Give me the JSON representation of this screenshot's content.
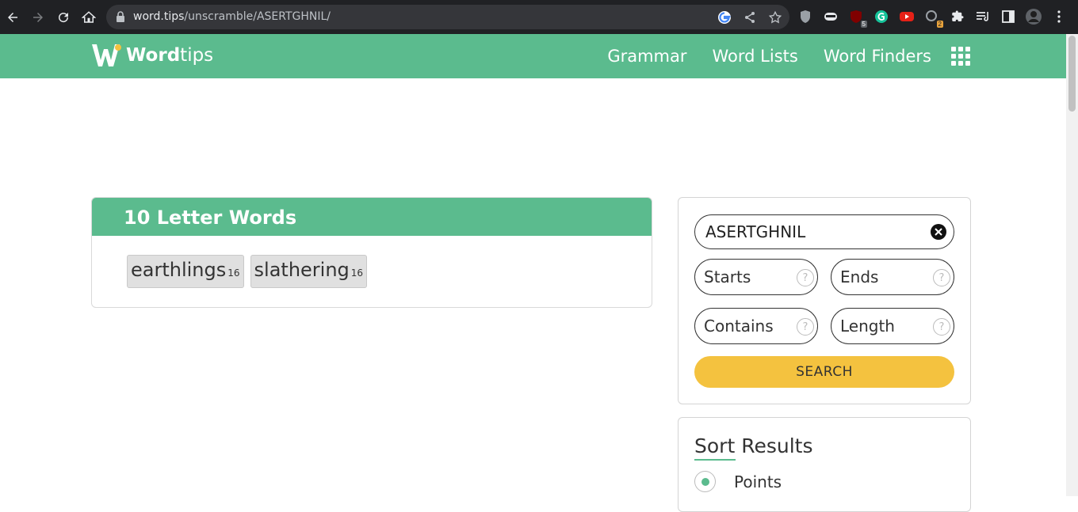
{
  "browser": {
    "url_host": "word.tips",
    "url_path": "/unscramble/ASERTGHNIL/",
    "extension_badges": {
      "ublock": "5",
      "ext_two": "2"
    }
  },
  "site": {
    "logo_bold": "Word",
    "logo_light": "tips",
    "nav": [
      "Grammar",
      "Word Lists",
      "Word Finders"
    ],
    "accent": "#5bbb8e",
    "button_color": "#f4c23f"
  },
  "results": {
    "heading": "10 Letter Words",
    "words": [
      {
        "word": "earthlings",
        "points": "16"
      },
      {
        "word": "slathering",
        "points": "16"
      }
    ]
  },
  "search": {
    "letters": "ASERTGHNIL",
    "starts_label": "Starts",
    "ends_label": "Ends",
    "contains_label": "Contains",
    "length_label": "Length",
    "help_glyph": "?",
    "button_label": "SEARCH"
  },
  "sort": {
    "title": "Sort Results",
    "selected_option": "Points"
  }
}
